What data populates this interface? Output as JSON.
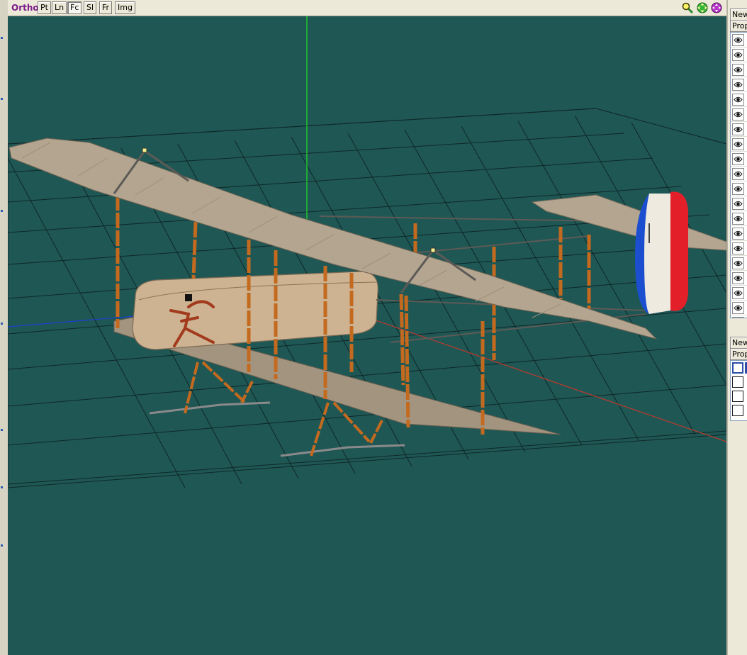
{
  "toolbar": {
    "mode_label": "Ortho",
    "buttons": [
      {
        "label": "Pt",
        "active": false
      },
      {
        "label": "Ln",
        "active": false
      },
      {
        "label": "Fc",
        "active": true
      },
      {
        "label": "Sl",
        "active": false
      },
      {
        "label": "Fr",
        "active": false
      },
      {
        "label": "Img",
        "active": false
      }
    ],
    "tools": [
      "zoom-icon",
      "pan-icon",
      "rotate-icon"
    ]
  },
  "viewport": {
    "background": "#1f5755",
    "grid_color": "#0f2a28",
    "axis_colors": {
      "x": "#c0392b",
      "y": "#22e022",
      "z": "#1e3fd0"
    }
  },
  "panel_top": {
    "new_label": "New",
    "prop_label": "Prop"
  },
  "panel_bottom": {
    "new_label": "New",
    "prop_label": "Prop"
  }
}
